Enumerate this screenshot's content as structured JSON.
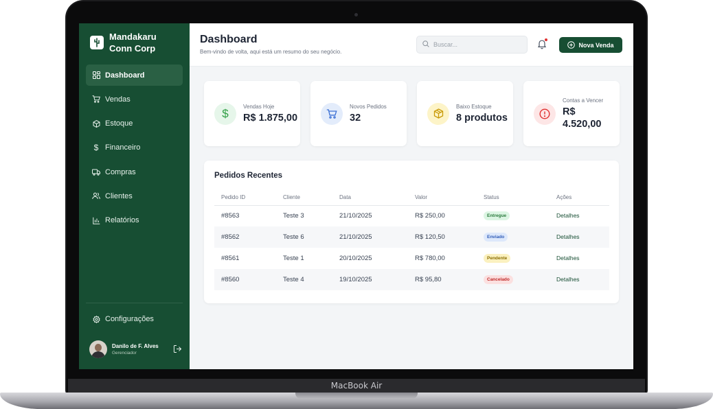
{
  "device": {
    "brand": "MacBook Air"
  },
  "sidebar": {
    "company": "Mandakaru Conn Corp",
    "items": [
      {
        "label": "Dashboard",
        "icon": "dashboard-icon",
        "active": true
      },
      {
        "label": "Vendas",
        "icon": "cart-icon"
      },
      {
        "label": "Estoque",
        "icon": "box-icon"
      },
      {
        "label": "Financeiro",
        "icon": "dollar-icon"
      },
      {
        "label": "Compras",
        "icon": "truck-icon"
      },
      {
        "label": "Clientes",
        "icon": "users-icon"
      },
      {
        "label": "Relatórios",
        "icon": "chart-icon"
      }
    ],
    "settings_label": "Configurações",
    "user": {
      "name": "Danilo de F. Alves",
      "role": "Gerenciador"
    }
  },
  "header": {
    "title": "Dashboard",
    "subtitle": "Bem-vindo de volta, aqui está um resumo do seu negócio.",
    "search_placeholder": "Buscar...",
    "new_sale_label": "Nova Venda"
  },
  "cards": [
    {
      "label": "Vendas Hoje",
      "value": "R$ 1.875,00",
      "icon": "dollar-icon",
      "color": "#2f9e44",
      "bg": "#e6f6ea"
    },
    {
      "label": "Novos Pedidos",
      "value": "32",
      "icon": "cart-icon",
      "color": "#3b6fd4",
      "bg": "#e3ecfb"
    },
    {
      "label": "Baixo Estoque",
      "value": "8 produtos",
      "icon": "box-icon",
      "color": "#c99a06",
      "bg": "#fdf4c8"
    },
    {
      "label": "Contas a Vencer",
      "value": "R$ 4.520,00",
      "icon": "alert-icon",
      "color": "#e03131",
      "bg": "#fde6e6"
    }
  ],
  "orders": {
    "title": "Pedidos Recentes",
    "columns": [
      "Pedido ID",
      "Cliente",
      "Data",
      "Valor",
      "Status",
      "Ações"
    ],
    "rows": [
      {
        "id": "#8563",
        "client": "Teste 3",
        "date": "21/10/2025",
        "value": "R$ 250,00",
        "status": "Entregue",
        "action": "Detalhes",
        "status_bg": "#dcf5e3",
        "status_color": "#2b7a3d"
      },
      {
        "id": "#8562",
        "client": "Teste 6",
        "date": "21/10/2025",
        "value": "R$ 120,50",
        "status": "Enviado",
        "action": "Detalhes",
        "status_bg": "#dde8fb",
        "status_color": "#2f5bb7"
      },
      {
        "id": "#8561",
        "client": "Teste 1",
        "date": "20/10/2025",
        "value": "R$ 780,00",
        "status": "Pendente",
        "action": "Detalhes",
        "status_bg": "#fbf1c0",
        "status_color": "#8a6d00"
      },
      {
        "id": "#8560",
        "client": "Teste 4",
        "date": "19/10/2025",
        "value": "R$ 95,80",
        "status": "Cancelado",
        "action": "Detalhes",
        "status_bg": "#fbe0e0",
        "status_color": "#c02828"
      }
    ]
  }
}
